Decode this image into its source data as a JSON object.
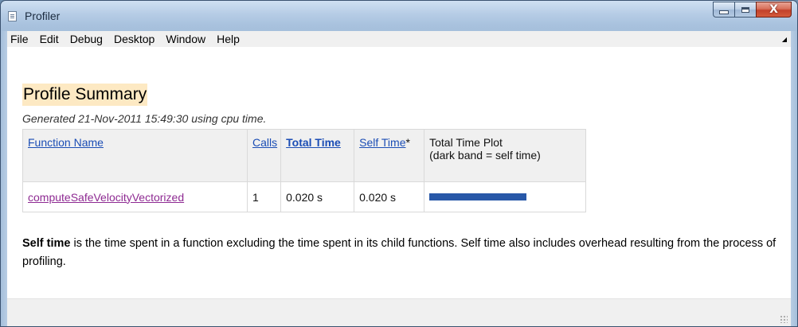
{
  "window": {
    "title": "Profiler",
    "controls": {
      "minimize_icon": "minimize-icon",
      "maximize_icon": "maximize-icon",
      "close_label": "X"
    }
  },
  "menubar": {
    "items": [
      "File",
      "Edit",
      "Debug",
      "Desktop",
      "Window",
      "Help"
    ],
    "undock_icon": "undock-arrow-icon"
  },
  "report": {
    "heading": "Profile Summary",
    "generated": "Generated 21-Nov-2011 15:49:30 using cpu time.",
    "table": {
      "headers": {
        "function_name": "Function Name",
        "calls": "Calls",
        "total_time": "Total Time",
        "self_time": "Self Time",
        "self_time_marker": "*",
        "plot_line1": "Total Time Plot",
        "plot_line2": "(dark band = self time)"
      },
      "rows": [
        {
          "function": "computeSafeVelocityVectorized",
          "calls": "1",
          "total_time": "0.020 s",
          "self_time": "0.020 s",
          "self_time_fraction": 1.0
        }
      ]
    },
    "note_bold": "Self time",
    "note_rest": " is the time spent in a function excluding the time spent in its child functions. Self time also includes overhead resulting from the process of profiling."
  },
  "colors": {
    "heading_highlight": "#fde9c3",
    "link": "#1b4db5",
    "visited_link": "#8e2a92",
    "bar": "#2858a8",
    "titlebar": "#a9c2de"
  }
}
